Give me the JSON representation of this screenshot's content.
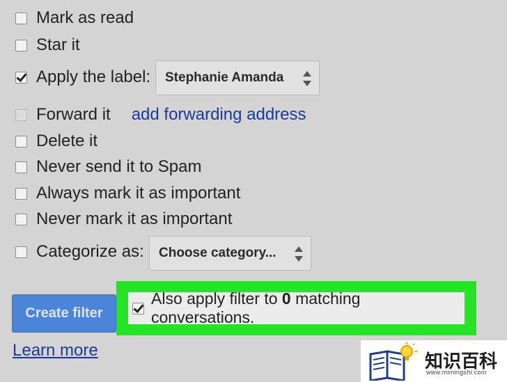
{
  "options": {
    "mark_as_read": {
      "label": "Mark as read",
      "checked": false
    },
    "star_it": {
      "label": "Star it",
      "checked": false
    },
    "apply_label": {
      "label": "Apply the label:",
      "checked": true,
      "selected": "Stephanie Amanda"
    },
    "forward_it": {
      "label": "Forward it",
      "checked": false,
      "disabled": true,
      "link": "add forwarding address"
    },
    "delete_it": {
      "label": "Delete it",
      "checked": false
    },
    "never_spam": {
      "label": "Never send it to Spam",
      "checked": false
    },
    "always_important": {
      "label": "Always mark it as important",
      "checked": false
    },
    "never_important": {
      "label": "Never mark it as important",
      "checked": false
    },
    "categorize": {
      "label": "Categorize as:",
      "checked": false,
      "selected": "Choose category..."
    }
  },
  "actions": {
    "create_filter": "Create filter",
    "also_apply_prefix": "Also apply filter to ",
    "also_apply_count": "0",
    "also_apply_suffix": " matching conversations.",
    "also_apply_checked": true,
    "learn_more": "Learn more"
  },
  "watermark": {
    "title": "知识百科",
    "url": "www.mimingshi.com",
    "icon": "book-bulb-icon"
  },
  "colors": {
    "highlight": "#25e425",
    "button": "#4a85d8",
    "link": "#1a3a9c"
  }
}
